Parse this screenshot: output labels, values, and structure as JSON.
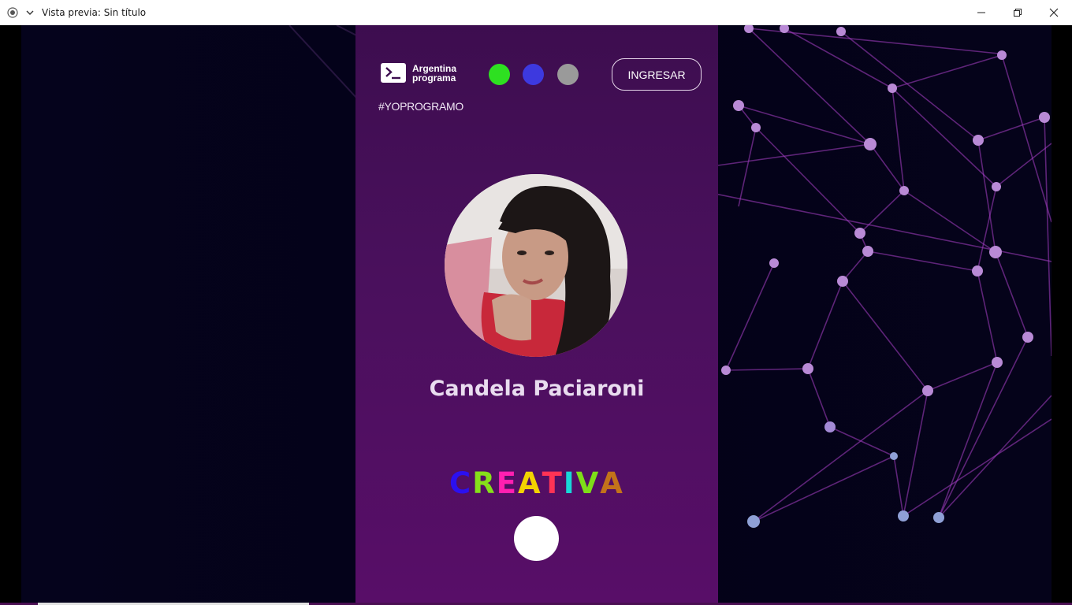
{
  "window": {
    "title": "Vista previa: Sin título"
  },
  "header": {
    "logo_line1": "Argentina",
    "logo_line2": "programa",
    "hashtag": "#YOPROGRAMO",
    "theme_dots": [
      {
        "name": "green",
        "color": "#2ee021"
      },
      {
        "name": "blue",
        "color": "#3d39df"
      },
      {
        "name": "gray",
        "color": "#9a9a9a"
      }
    ],
    "login_label": "INGRESAR"
  },
  "profile": {
    "name": "Candela Paciaroni",
    "word_letters": [
      {
        "char": "C",
        "color": "#2b10f0"
      },
      {
        "char": "R",
        "color": "#86e01a"
      },
      {
        "char": "E",
        "color": "#ff1fb0"
      },
      {
        "char": "A",
        "color": "#f3d300"
      },
      {
        "char": "T",
        "color": "#ff3355"
      },
      {
        "char": "I",
        "color": "#18d8d8"
      },
      {
        "char": "V",
        "color": "#7ede18"
      },
      {
        "char": "A",
        "color": "#c3731a"
      }
    ]
  },
  "colors": {
    "panel": "#49105c",
    "background": "#05031c",
    "network_line": "#a73fc6",
    "network_node": "#b98ad6"
  }
}
